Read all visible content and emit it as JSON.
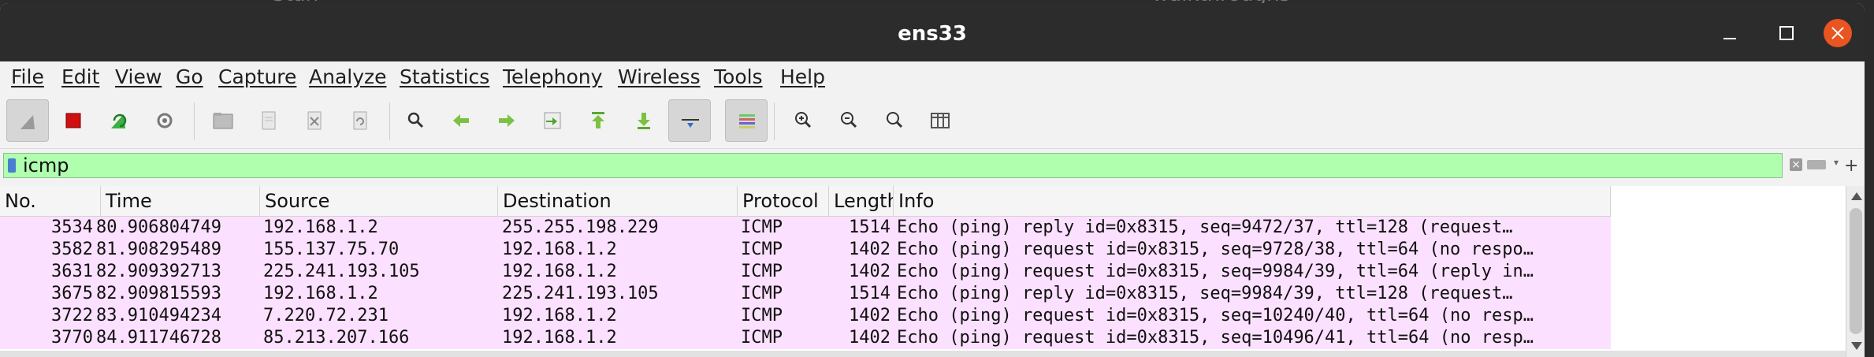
{
  "backdrop": {
    "left_text": "Stan",
    "right_text": "walkthroughs"
  },
  "window": {
    "title": "ens33"
  },
  "menu": [
    "File",
    "Edit",
    "View",
    "Go",
    "Capture",
    "Analyze",
    "Statistics",
    "Telephony",
    "Wireless",
    "Tools",
    "Help"
  ],
  "toolbar_icons": [
    "shark-fin-start-icon",
    "stop-capture-icon",
    "restart-capture-icon",
    "capture-options-icon",
    "open-file-icon",
    "save-file-icon",
    "close-file-icon",
    "reload-file-icon",
    "find-packet-icon",
    "go-back-icon",
    "go-forward-icon",
    "go-to-packet-icon",
    "go-first-packet-icon",
    "go-last-packet-icon",
    "auto-scroll-icon",
    "colorize-icon",
    "zoom-in-icon",
    "zoom-out-icon",
    "normal-size-icon",
    "resize-columns-icon"
  ],
  "filter": {
    "value": "icmp",
    "background": "#afffaf"
  },
  "columns": [
    "No.",
    "Time",
    "Source",
    "Destination",
    "Protocol",
    "Length",
    "Info"
  ],
  "packets": [
    {
      "no": "3534",
      "time": "80.906804749",
      "src": "192.168.1.2",
      "dst": "255.255.198.229",
      "proto": "ICMP",
      "len": "1514",
      "info": "Echo (ping) reply    id=0x8315, seq=9472/37, ttl=128 (request…"
    },
    {
      "no": "3582",
      "time": "81.908295489",
      "src": "155.137.75.70",
      "dst": "192.168.1.2",
      "proto": "ICMP",
      "len": "1402",
      "info": "Echo (ping) request  id=0x8315, seq=9728/38, ttl=64 (no respo…"
    },
    {
      "no": "3631",
      "time": "82.909392713",
      "src": "225.241.193.105",
      "dst": "192.168.1.2",
      "proto": "ICMP",
      "len": "1402",
      "info": "Echo (ping) request  id=0x8315, seq=9984/39, ttl=64 (reply in…"
    },
    {
      "no": "3675",
      "time": "82.909815593",
      "src": "192.168.1.2",
      "dst": "225.241.193.105",
      "proto": "ICMP",
      "len": "1514",
      "info": "Echo (ping) reply    id=0x8315, seq=9984/39, ttl=128 (request…"
    },
    {
      "no": "3722",
      "time": "83.910494234",
      "src": "7.220.72.231",
      "dst": "192.168.1.2",
      "proto": "ICMP",
      "len": "1402",
      "info": "Echo (ping) request  id=0x8315, seq=10240/40, ttl=64 (no resp…"
    },
    {
      "no": "3770",
      "time": "84.911746728",
      "src": "85.213.207.166",
      "dst": "192.168.1.2",
      "proto": "ICMP",
      "len": "1402",
      "info": "Echo (ping) request  id=0x8315, seq=10496/41, ttl=64 (no resp…"
    }
  ],
  "row_color": "#fce0ff"
}
